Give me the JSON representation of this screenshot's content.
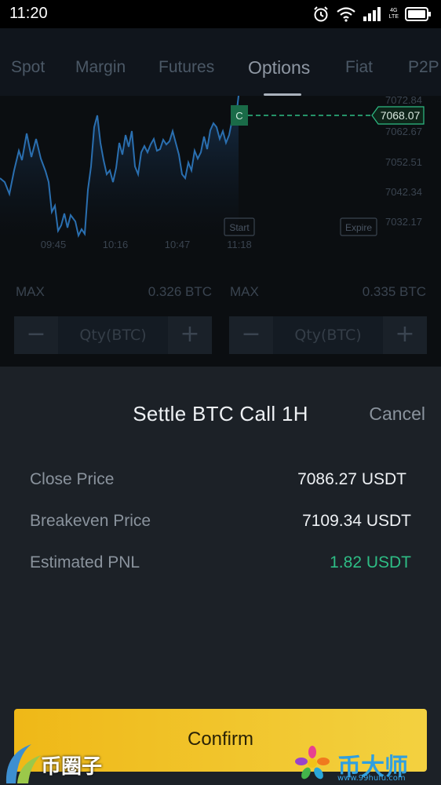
{
  "status_bar": {
    "time": "11:20",
    "network": "4G",
    "network_sub": "LTE",
    "icons": [
      "alarm-icon",
      "wifi-icon",
      "signal-icon",
      "battery-icon"
    ]
  },
  "tabs": {
    "items": [
      {
        "label": "Spot"
      },
      {
        "label": "Margin"
      },
      {
        "label": "Futures"
      },
      {
        "label": "Options"
      },
      {
        "label": "Fiat"
      },
      {
        "label": "P2P"
      }
    ],
    "active": "Options"
  },
  "chart": {
    "y_ticks": [
      "7072.84",
      "7062.67",
      "7052.51",
      "7042.34",
      "7032.17"
    ],
    "x_ticks": [
      "09:45",
      "10:16",
      "10:47",
      "11:18"
    ],
    "current_price": "7068.07",
    "marker_label": "C",
    "start_label": "Start",
    "expire_label": "Expire",
    "line_color": "#2a6fb0",
    "marker_color": "#2ebd85"
  },
  "trade": {
    "left": {
      "max_label": "MAX",
      "max_value": "0.326 BTC",
      "qty_placeholder": "Qty(BTC)",
      "minus": "−",
      "plus": "+"
    },
    "right": {
      "max_label": "MAX",
      "max_value": "0.335 BTC",
      "qty_placeholder": "Qty(BTC)",
      "minus": "−",
      "plus": "+"
    }
  },
  "sheet": {
    "title": "Settle BTC Call 1H",
    "cancel": "Cancel",
    "rows": [
      {
        "label": "Close Price",
        "value": "7086.27 USDT"
      },
      {
        "label": "Breakeven Price",
        "value": "7109.34 USDT"
      },
      {
        "label": "Estimated PNL",
        "value": "1.82 USDT"
      }
    ],
    "confirm": "Confirm",
    "pnl_color": "#2ebd85",
    "confirm_color": "#f0b90b"
  },
  "watermarks": {
    "left": "币圈子",
    "right": "币大师",
    "right_url": "www.99hufu.com"
  }
}
